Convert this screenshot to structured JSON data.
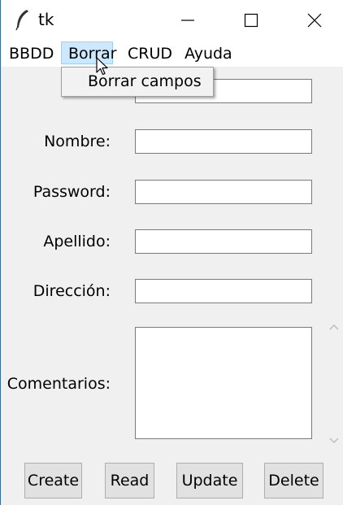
{
  "window": {
    "title": "tk"
  },
  "menubar": {
    "items": [
      {
        "label": "BBDD"
      },
      {
        "label": "Borrar"
      },
      {
        "label": "CRUD"
      },
      {
        "label": "Ayuda"
      }
    ],
    "open_menu": "Borrar",
    "dropdown": {
      "items": [
        {
          "label": "Borrar campos"
        }
      ]
    }
  },
  "form": {
    "fields": [
      {
        "label": "",
        "value": ""
      },
      {
        "label": "Nombre:",
        "value": ""
      },
      {
        "label": "Password:",
        "value": ""
      },
      {
        "label": "Apellido:",
        "value": ""
      },
      {
        "label": "Dirección:",
        "value": ""
      }
    ],
    "comments": {
      "label": "Comentarios:",
      "value": ""
    }
  },
  "buttons": {
    "create": "Create",
    "read": "Read",
    "update": "Update",
    "delete": "Delete"
  },
  "icons": {
    "app": "feather-icon",
    "minimize": "minimize-icon",
    "maximize": "maximize-icon",
    "close": "close-icon",
    "cursor": "mouse-pointer-icon",
    "scroll_up": "chevron-up-icon",
    "scroll_down": "chevron-down-icon"
  },
  "colors": {
    "menu_highlight": "#cce8ff",
    "window_bg": "#f0f0f0",
    "border_accent": "#2b6cb3"
  }
}
